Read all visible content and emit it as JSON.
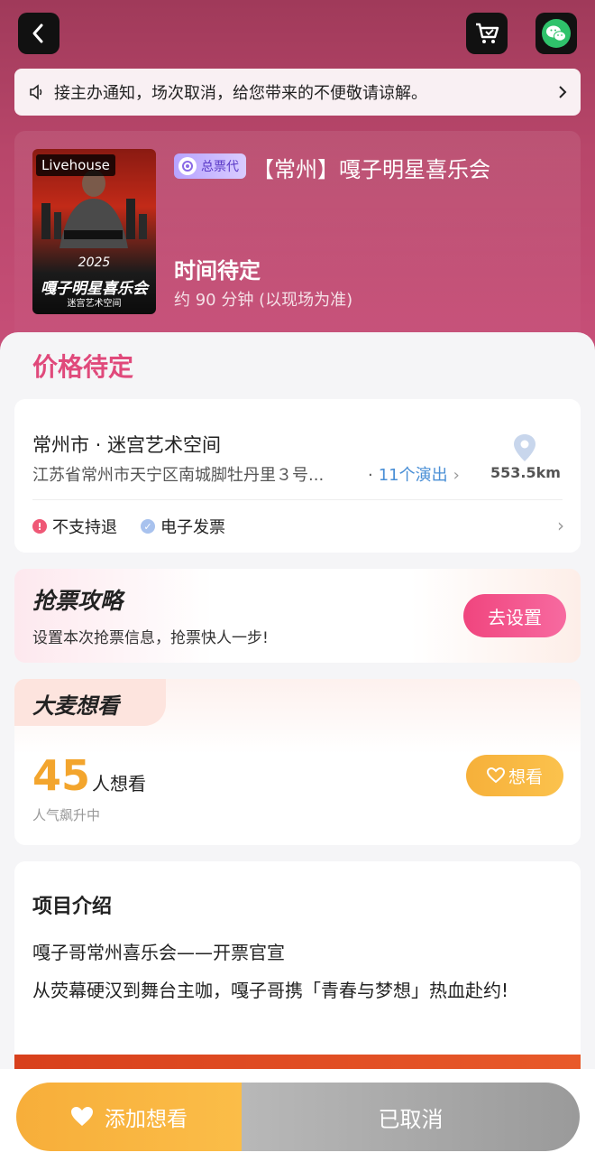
{
  "notice": {
    "text": "接主办通知，场次取消，给您带来的不便敬请谅解。"
  },
  "event": {
    "poster_badge": "Livehouse",
    "poster_year": "2025",
    "poster_title": "嘎子明星喜乐会",
    "poster_subtitle": "迷宫艺术空间",
    "agent_badge": "总票代",
    "title": "【常州】嘎子明星喜乐会",
    "time": "时间待定",
    "duration": "约 90 分钟 (以现场为准)"
  },
  "price": {
    "label": "价格待定"
  },
  "venue": {
    "name": "常州市 · 迷宫艺术空间",
    "address": "江苏省常州市天宁区南城脚牡丹里３号...",
    "separator": "·",
    "shows": "11个演出",
    "distance": "553.5km",
    "tags": [
      "不支持退",
      "电子发票"
    ]
  },
  "strategy": {
    "title": "抢票攻略",
    "description": "设置本次抢票信息，抢票快人一步!",
    "button": "去设置"
  },
  "wish": {
    "title": "大麦想看",
    "count": "45",
    "unit": "人想看",
    "trend": "人气飙升中",
    "button": "想看"
  },
  "intro": {
    "title": "项目介绍",
    "line1": "嘎子哥常州喜乐会——开票官宣",
    "line2": "从荧幕硬汉到舞台主咖，嘎子哥携「青春与梦想」热血赴约!"
  },
  "actions": {
    "add_want": "添加想看",
    "status": "已取消"
  },
  "colors": {
    "accent_pink": "#e0497b",
    "accent_orange": "#f3a52d",
    "link_blue": "#4a8fd6"
  }
}
